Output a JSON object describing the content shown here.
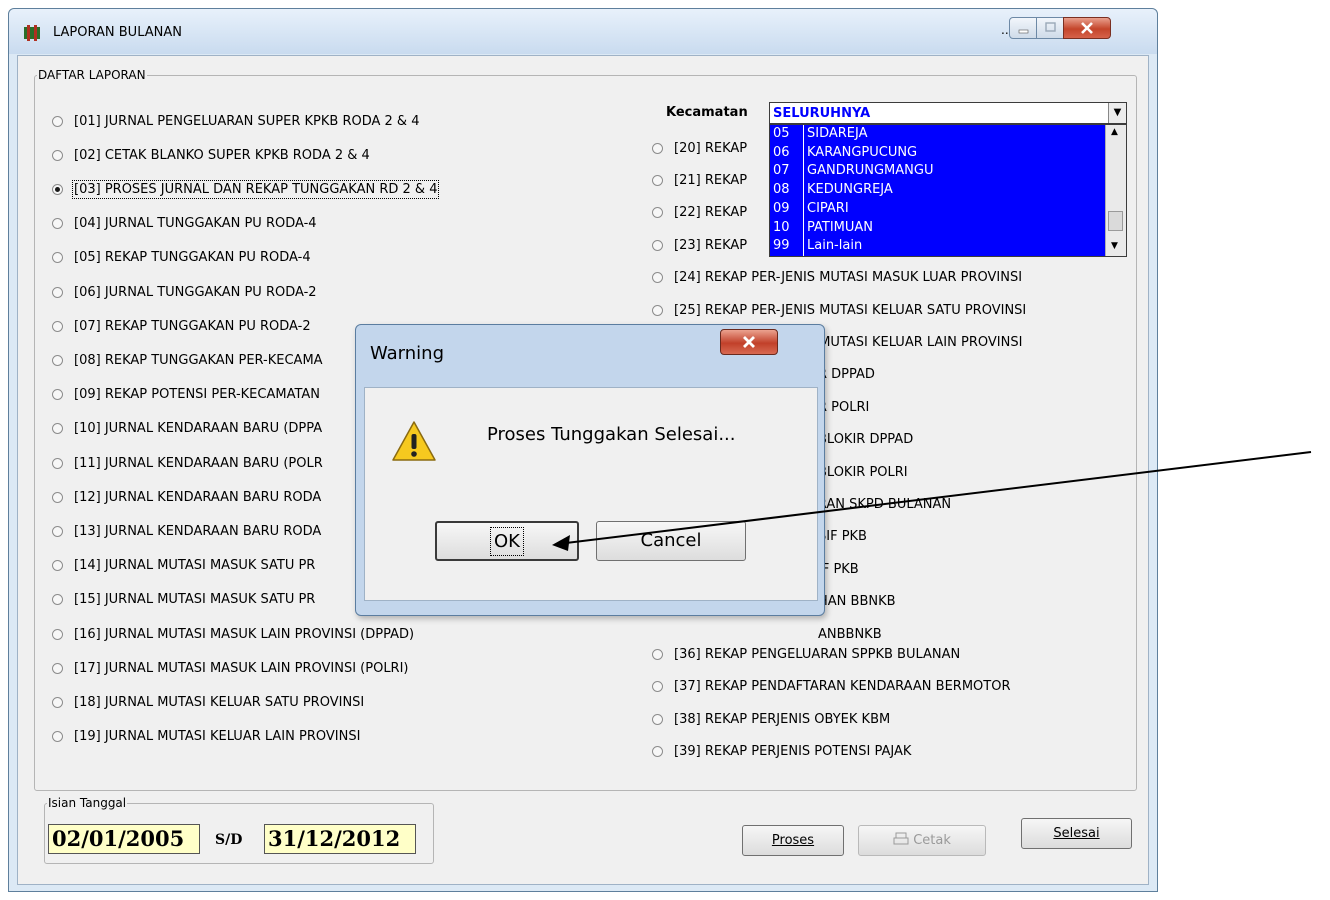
{
  "window": {
    "title": "LAPORAN BULANAN",
    "title_dots": "..."
  },
  "group_daftar": "DAFTAR LAPORAN",
  "left_reports": [
    "[01] JURNAL PENGELUARAN SUPER KPKB  RODA 2 & 4",
    "[02] CETAK BLANKO SUPER KPKB  RODA 2 & 4",
    "[03] PROSES JURNAL DAN REKAP TUNGGAKAN RD 2 & 4",
    "[04] JURNAL TUNGGAKAN PU RODA-4",
    "[05]  REKAP  TUNGGAKAN PU RODA-4",
    "[06] JURNAL TUNGGAKAN PU RODA-2",
    "[07] REKAP   TUNGGAKAN PU RODA-2",
    "[08] REKAP  TUNGGAKAN PER-KECAMA",
    "[09] REKAP  POTENSI PER-KECAMATAN",
    "[10] JURNAL KENDARAAN BARU (DPPA",
    "[11] JURNAL KENDARAAN BARU (POLR",
    "[12] JURNAL KENDARAAN BARU RODA",
    "[13] JURNAL KENDARAAN BARU RODA",
    "[14] JURNAL MUTASI MASUK SATU PR",
    "[15] JURNAL MUTASI MASUK SATU PR",
    "[16] JURNAL MUTASI MASUK LAIN PROVINSI  (DPPAD)",
    "[17] JURNAL MUTASI MASUK LAIN PROVINSI  (POLRI)",
    "[18] JURNAL MUTASI KELUAR SATU PROVINSI",
    "[19] JURNAL MUTASI KELUAR LAIN PROVINSI"
  ],
  "selected_report": "[03] PROSES JURNAL DAN REKAP TUNGGAKAN RD 2 & 4",
  "right_reports": [
    "[20] REKAP",
    "[21] REKAP",
    "[22] REKAP",
    "[23] REKAP",
    "[24] REKAP PER-JENIS MUTASI MASUK LUAR PROVINSI",
    "[25] REKAP PER-JENIS MUTASI KELUAR SATU PROVINSI",
    "[26] REKAP PER-JENIS MUTASI KELUAR LAIN PROVINSI",
    "R DPPAD",
    "R POLRI",
    "BLOKIR DPPAD",
    "BLOKIR POLRI",
    "ARAN SKPD BULANAN",
    "SIF PKB",
    "IF  PKB",
    "HAN BBNKB",
    "ANBBNKB",
    "[36] REKAP PENGELUARAN SPPKB BULANAN",
    "[37] REKAP PENDAFTARAN KENDARAAN BERMOTOR",
    "[38] REKAP PERJENIS OBYEK KBM",
    "[39] REKAP PERJENIS POTENSI PAJAK"
  ],
  "kecamatan": {
    "label": "Kecamatan",
    "value": "SELURUHNYA",
    "options": [
      {
        "code": "05",
        "name": "SIDAREJA"
      },
      {
        "code": "06",
        "name": "KARANGPUCUNG"
      },
      {
        "code": "07",
        "name": "GANDRUNGMANGU"
      },
      {
        "code": "08",
        "name": "KEDUNGREJA"
      },
      {
        "code": "09",
        "name": "CIPARI"
      },
      {
        "code": "10",
        "name": "PATIMUAN"
      },
      {
        "code": "99",
        "name": "Lain-lain"
      }
    ]
  },
  "tanggal": {
    "legend": "Isian Tanggal",
    "from": "02/01/2005",
    "sep": "S/D",
    "to": "31/12/2012"
  },
  "buttons": {
    "proses": "Proses",
    "cetak": "Cetak",
    "selesai": "Selesai"
  },
  "dialog": {
    "title": "Warning",
    "message": "Proses Tunggakan Selesai...",
    "ok": "OK",
    "cancel": "Cancel"
  }
}
